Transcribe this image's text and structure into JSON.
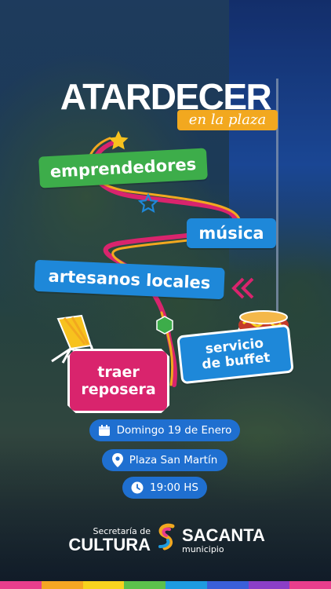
{
  "title": {
    "main": "ATARDECER",
    "sub": "en la plaza"
  },
  "tags": {
    "emprendedores": "emprendedores",
    "musica": "música",
    "artesanos": "artesanos locales",
    "reposera_line1": "traer",
    "reposera_line2": "reposera",
    "buffet_line1": "servicio",
    "buffet_line2": "de buffet"
  },
  "info": {
    "date": "Domingo 19 de Enero",
    "place": "Plaza San Martín",
    "time": "19:00 HS"
  },
  "footer": {
    "cultura_small": "Secretaría de",
    "cultura_big": "CULTURA",
    "sacanta_big": "SACANTA",
    "sacanta_small": "municipio"
  },
  "colors": {
    "green": "#3dad4a",
    "blue": "#1e88d9",
    "pink": "#d9246d",
    "orange": "#f2a81f",
    "stripe": [
      "#e83e8c",
      "#f5a623",
      "#f7d31e",
      "#5cc04b",
      "#1e9be0",
      "#3a5fd9",
      "#8b3fc7",
      "#e83e8c"
    ]
  },
  "icons": [
    "star-icon",
    "calendar-icon",
    "location-pin-icon",
    "clock-icon",
    "beach-chair-icon",
    "hotdog-icon",
    "double-chevron-left-icon",
    "sacanta-logo-icon"
  ]
}
